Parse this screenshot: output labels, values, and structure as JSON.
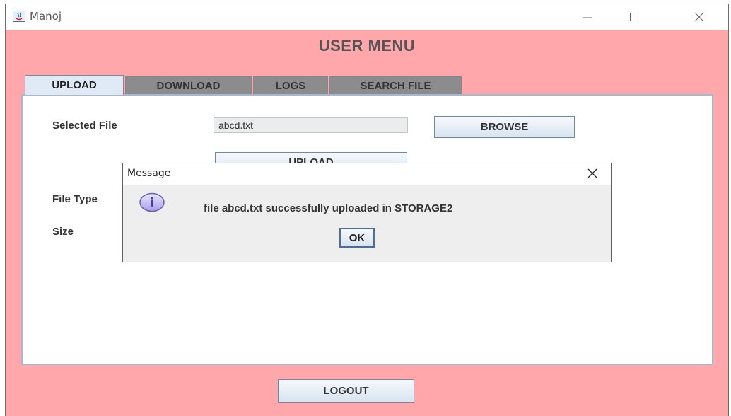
{
  "window": {
    "title": "Manoj"
  },
  "menu_title": "USER MENU",
  "tabs": [
    {
      "label": "UPLOAD",
      "active": true
    },
    {
      "label": "DOWNLOAD",
      "active": false
    },
    {
      "label": "LOGS",
      "active": false
    },
    {
      "label": "SEARCH FILE",
      "active": false
    }
  ],
  "upload_panel": {
    "selected_file_label": "Selected File",
    "selected_file_value": "abcd.txt",
    "browse_label": "BROWSE",
    "upload_label": "UPLOAD",
    "file_type_label": "File Type",
    "size_label": "Size"
  },
  "dialog": {
    "title": "Message",
    "message": "file abcd.txt successfully uploaded in STORAGE2",
    "ok_label": "OK",
    "icon": "info-icon"
  },
  "logout_label": "LOGOUT",
  "colors": {
    "background": "#ffa7aa",
    "panel_border": "#9fbad2",
    "active_tab": "#dfeaf6",
    "inactive_tab": "#8c8c8c"
  }
}
